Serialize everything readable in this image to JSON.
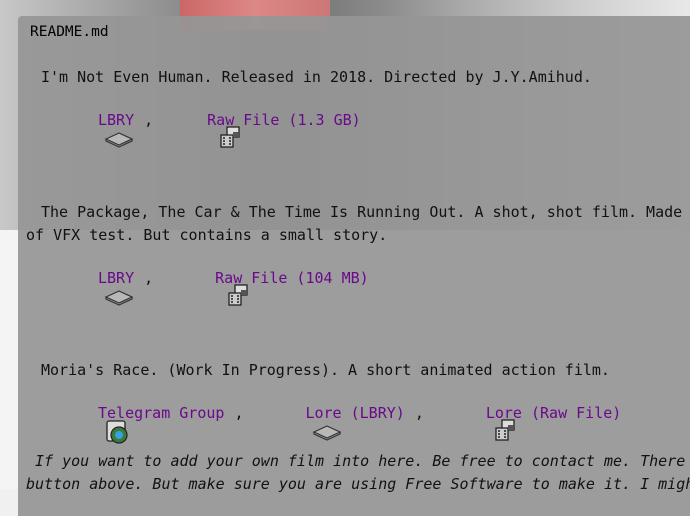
{
  "readme": {
    "title": "README.md",
    "entries": [
      {
        "description": "I'm Not Even Human. Released in 2018. Directed by J.Y.Amihud.",
        "links": [
          {
            "label": "LBRY",
            "icon": "stack-icon"
          },
          {
            "label": "Raw File (1.3 GB)",
            "icon": "film-icon"
          }
        ]
      },
      {
        "description_line1": "The Package, The Car & The Time Is Running Out. A shot, shot film. Made",
        "description_line2": "of VFX test. But contains a small story.",
        "links": [
          {
            "label": "LBRY",
            "icon": "stack-icon"
          },
          {
            "label": "Raw File (104 MB)",
            "icon": "film-icon"
          }
        ]
      },
      {
        "description": "Moria's Race. (Work In Progress). A short animated action film.",
        "links": [
          {
            "label": "Telegram Group",
            "icon": "telegram-icon"
          },
          {
            "label": "Lore (LBRY)",
            "icon": "stack-icon"
          },
          {
            "label": "Lore (Raw File)",
            "icon": "film-icon"
          }
        ]
      }
    ],
    "footer_line1": " If you want to add your own film into here. Be free to contact me. There",
    "footer_line2": "button above. But make sure you are using Free Software to make it. I migh",
    "separator": ","
  }
}
